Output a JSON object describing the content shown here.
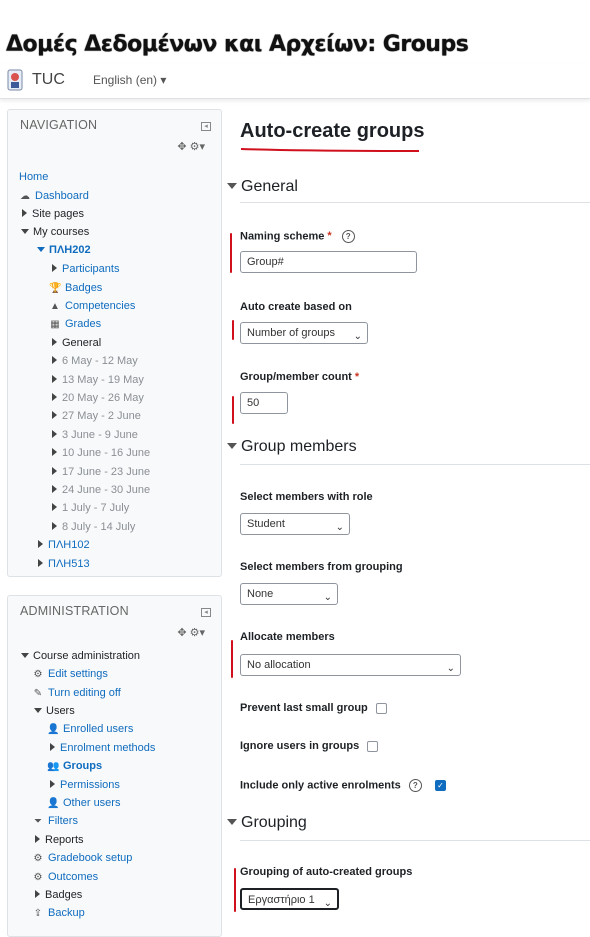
{
  "slide_title": "Δομές Δεδομένων και Αρχείων: Groups",
  "navbar": {
    "site_name": "TUC",
    "language": "English (en)"
  },
  "navigation": {
    "title": "NAVIGATION",
    "items": [
      {
        "label": "Home"
      },
      {
        "label": "Dashboard"
      },
      {
        "label": "Site pages"
      },
      {
        "label": "My courses"
      },
      {
        "label": "ΠΛΗ202"
      },
      {
        "label": "Participants"
      },
      {
        "label": "Badges"
      },
      {
        "label": "Competencies"
      },
      {
        "label": "Grades"
      },
      {
        "label": "General"
      },
      {
        "label": "6 May - 12 May"
      },
      {
        "label": "13 May - 19 May"
      },
      {
        "label": "20 May - 26 May"
      },
      {
        "label": "27 May - 2 June"
      },
      {
        "label": "3 June - 9 June"
      },
      {
        "label": "10 June - 16 June"
      },
      {
        "label": "17 June - 23 June"
      },
      {
        "label": "24 June - 30 June"
      },
      {
        "label": "1 July - 7 July"
      },
      {
        "label": "8 July - 14 July"
      },
      {
        "label": "ΠΛΗ102"
      },
      {
        "label": "ΠΛΗ513"
      }
    ]
  },
  "administration": {
    "title": "ADMINISTRATION",
    "items": [
      {
        "label": "Course administration"
      },
      {
        "label": "Edit settings"
      },
      {
        "label": "Turn editing off"
      },
      {
        "label": "Users"
      },
      {
        "label": "Enrolled users"
      },
      {
        "label": "Enrolment methods"
      },
      {
        "label": "Groups"
      },
      {
        "label": "Permissions"
      },
      {
        "label": "Other users"
      },
      {
        "label": "Filters"
      },
      {
        "label": "Reports"
      },
      {
        "label": "Gradebook setup"
      },
      {
        "label": "Outcomes"
      },
      {
        "label": "Badges"
      },
      {
        "label": "Backup"
      }
    ]
  },
  "main": {
    "page_title": "Auto-create groups",
    "sections": {
      "general": "General",
      "group_members": "Group members",
      "grouping": "Grouping"
    },
    "fields": {
      "naming_scheme": {
        "label": "Naming scheme",
        "value": "Group#"
      },
      "auto_create_based_on": {
        "label": "Auto create based on",
        "value": "Number of groups"
      },
      "group_member_count": {
        "label": "Group/member count",
        "value": "50"
      },
      "select_members_with_role": {
        "label": "Select members with role",
        "value": "Student"
      },
      "select_members_from_grouping": {
        "label": "Select members from grouping",
        "value": "None"
      },
      "allocate_members": {
        "label": "Allocate members",
        "value": "No allocation"
      },
      "prevent_last_small_group": {
        "label": "Prevent last small group",
        "checked": false
      },
      "ignore_users_in_groups": {
        "label": "Ignore users in groups",
        "checked": false
      },
      "include_only_active_enrolments": {
        "label": "Include only active enrolments",
        "checked": true
      },
      "grouping_of_auto_created_groups": {
        "label": "Grouping of auto-created groups",
        "value": "Εργαστήριο 1"
      }
    },
    "required_marker": "*"
  },
  "colors": {
    "link": "#0f6cbf",
    "annotation": "#d0101d"
  }
}
